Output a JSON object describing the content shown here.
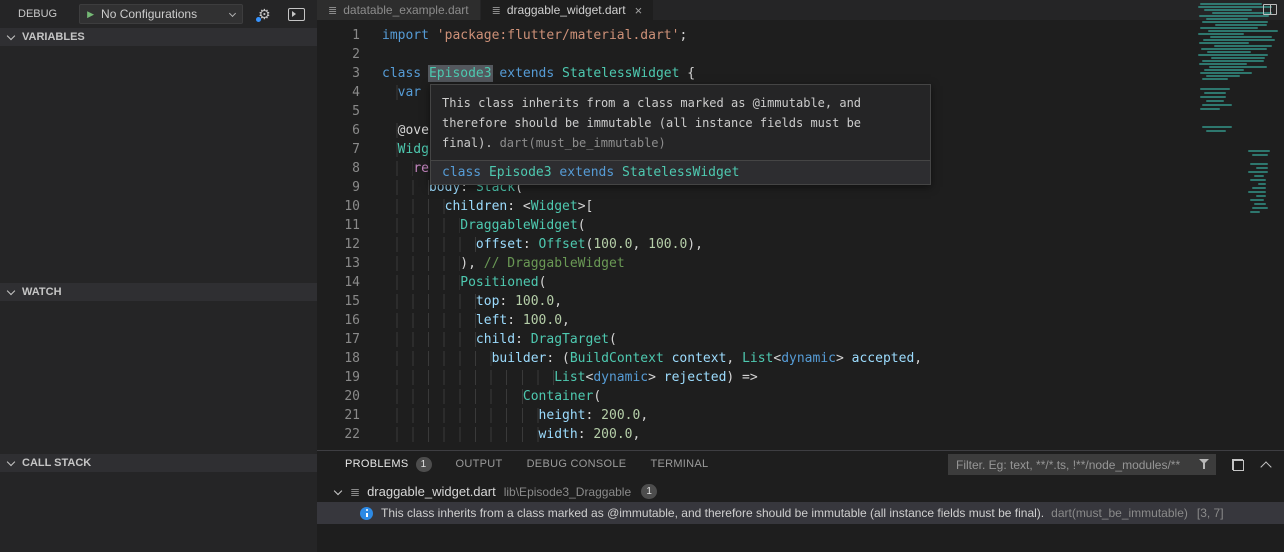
{
  "icons": {
    "file_glyph": "≣",
    "gear_glyph": "⚙",
    "play_glyph": "▶",
    "close_glyph": "×"
  },
  "sidebar": {
    "debug_label": "DEBUG",
    "config_label": "No Configurations",
    "sections": [
      "VARIABLES",
      "WATCH",
      "CALL STACK"
    ]
  },
  "editor": {
    "tabs": [
      {
        "label": "datatable_example.dart",
        "active": false
      },
      {
        "label": "draggable_widget.dart",
        "active": true
      }
    ],
    "lines": [
      {
        "n": "1",
        "t": [
          [
            "k",
            "import"
          ],
          [
            "d",
            " "
          ],
          [
            "s",
            "'package:flutter/material.dart'"
          ],
          [
            "d",
            ";"
          ]
        ]
      },
      {
        "n": "2",
        "t": []
      },
      {
        "n": "3",
        "t": [
          [
            "k",
            "class"
          ],
          [
            "d",
            " "
          ],
          [
            "th",
            "Episode3"
          ],
          [
            "d",
            " "
          ],
          [
            "k",
            "extends"
          ],
          [
            "d",
            " "
          ],
          [
            "t",
            "StatelessWidget"
          ],
          [
            "d",
            " {"
          ]
        ]
      },
      {
        "n": "4",
        "t": [
          [
            "d",
            "  "
          ],
          [
            "k",
            "var"
          ]
        ]
      },
      {
        "n": "5",
        "t": []
      },
      {
        "n": "6",
        "t": [
          [
            "d",
            "  @ove"
          ]
        ]
      },
      {
        "n": "7",
        "t": [
          [
            "d",
            "  "
          ],
          [
            "t",
            "Widg"
          ]
        ]
      },
      {
        "n": "8",
        "t": [
          [
            "d",
            "    "
          ],
          [
            "c",
            "re"
          ]
        ]
      },
      {
        "n": "9",
        "t": [
          [
            "d",
            "      "
          ],
          [
            "p",
            "body"
          ],
          [
            "d",
            ": "
          ],
          [
            "t",
            "Stack"
          ],
          [
            "d",
            "("
          ]
        ]
      },
      {
        "n": "10",
        "t": [
          [
            "d",
            "        "
          ],
          [
            "p",
            "children"
          ],
          [
            "d",
            ": <"
          ],
          [
            "t",
            "Widget"
          ],
          [
            "d",
            ">["
          ]
        ]
      },
      {
        "n": "11",
        "t": [
          [
            "d",
            "          "
          ],
          [
            "t",
            "DraggableWidget"
          ],
          [
            "d",
            "("
          ]
        ]
      },
      {
        "n": "12",
        "t": [
          [
            "d",
            "            "
          ],
          [
            "p",
            "offset"
          ],
          [
            "d",
            ": "
          ],
          [
            "t",
            "Offset"
          ],
          [
            "d",
            "("
          ],
          [
            "num",
            "100.0"
          ],
          [
            "d",
            ", "
          ],
          [
            "num",
            "100.0"
          ],
          [
            "d",
            "),"
          ]
        ]
      },
      {
        "n": "13",
        "t": [
          [
            "d",
            "          ), "
          ],
          [
            "m",
            "// DraggableWidget"
          ]
        ]
      },
      {
        "n": "14",
        "t": [
          [
            "d",
            "          "
          ],
          [
            "t",
            "Positioned"
          ],
          [
            "d",
            "("
          ]
        ]
      },
      {
        "n": "15",
        "t": [
          [
            "d",
            "            "
          ],
          [
            "p",
            "top"
          ],
          [
            "d",
            ": "
          ],
          [
            "num",
            "100.0"
          ],
          [
            "d",
            ","
          ]
        ]
      },
      {
        "n": "16",
        "t": [
          [
            "d",
            "            "
          ],
          [
            "p",
            "left"
          ],
          [
            "d",
            ": "
          ],
          [
            "num",
            "100.0"
          ],
          [
            "d",
            ","
          ]
        ]
      },
      {
        "n": "17",
        "t": [
          [
            "d",
            "            "
          ],
          [
            "p",
            "child"
          ],
          [
            "d",
            ": "
          ],
          [
            "t",
            "DragTarget"
          ],
          [
            "d",
            "("
          ]
        ]
      },
      {
        "n": "18",
        "t": [
          [
            "d",
            "              "
          ],
          [
            "p",
            "builder"
          ],
          [
            "d",
            ": ("
          ],
          [
            "t",
            "BuildContext"
          ],
          [
            "d",
            " "
          ],
          [
            "p",
            "context"
          ],
          [
            "d",
            ", "
          ],
          [
            "t",
            "List"
          ],
          [
            "d",
            "<"
          ],
          [
            "k",
            "dynamic"
          ],
          [
            "d",
            "> "
          ],
          [
            "p",
            "accepted"
          ],
          [
            "d",
            ","
          ]
        ]
      },
      {
        "n": "19",
        "t": [
          [
            "d",
            "                      "
          ],
          [
            "t",
            "List"
          ],
          [
            "d",
            "<"
          ],
          [
            "k",
            "dynamic"
          ],
          [
            "d",
            "> "
          ],
          [
            "p",
            "rejected"
          ],
          [
            "d",
            ") =>"
          ]
        ]
      },
      {
        "n": "20",
        "t": [
          [
            "d",
            "                  "
          ],
          [
            "t",
            "Container"
          ],
          [
            "d",
            "("
          ]
        ]
      },
      {
        "n": "21",
        "t": [
          [
            "d",
            "                    "
          ],
          [
            "p",
            "height"
          ],
          [
            "d",
            ": "
          ],
          [
            "num",
            "200.0"
          ],
          [
            "d",
            ","
          ]
        ]
      },
      {
        "n": "22",
        "t": [
          [
            "d",
            "                    "
          ],
          [
            "p",
            "width"
          ],
          [
            "d",
            ": "
          ],
          [
            "num",
            "200.0"
          ],
          [
            "d",
            ","
          ]
        ]
      }
    ]
  },
  "hover": {
    "line1": "This class inherits from a class marked as @immutable, and",
    "line2": "therefore should be immutable (all instance fields must be",
    "line3": "final).",
    "source": "dart(must_be_immutable)",
    "signature": [
      [
        "k",
        "class"
      ],
      [
        "d",
        " "
      ],
      [
        "t",
        "Episode3"
      ],
      [
        "d",
        " "
      ],
      [
        "k",
        "extends"
      ],
      [
        "d",
        " "
      ],
      [
        "t",
        "StatelessWidget"
      ]
    ]
  },
  "panel": {
    "tabs": [
      {
        "label": "PROBLEMS",
        "badge": "1",
        "active": true
      },
      {
        "label": "OUTPUT"
      },
      {
        "label": "DEBUG CONSOLE"
      },
      {
        "label": "TERMINAL"
      }
    ],
    "filter_placeholder": "Filter. Eg: text, **/*.ts, !**/node_modules/**",
    "file_group": {
      "name": "draggable_widget.dart",
      "path": "lib\\Episode3_Draggable",
      "count": "1"
    },
    "problem": {
      "message": "This class inherits from a class marked as @immutable, and therefore should be immutable (all instance fields must be final).",
      "source": "dart(must_be_immutable)",
      "position": "[3, 7]"
    }
  }
}
